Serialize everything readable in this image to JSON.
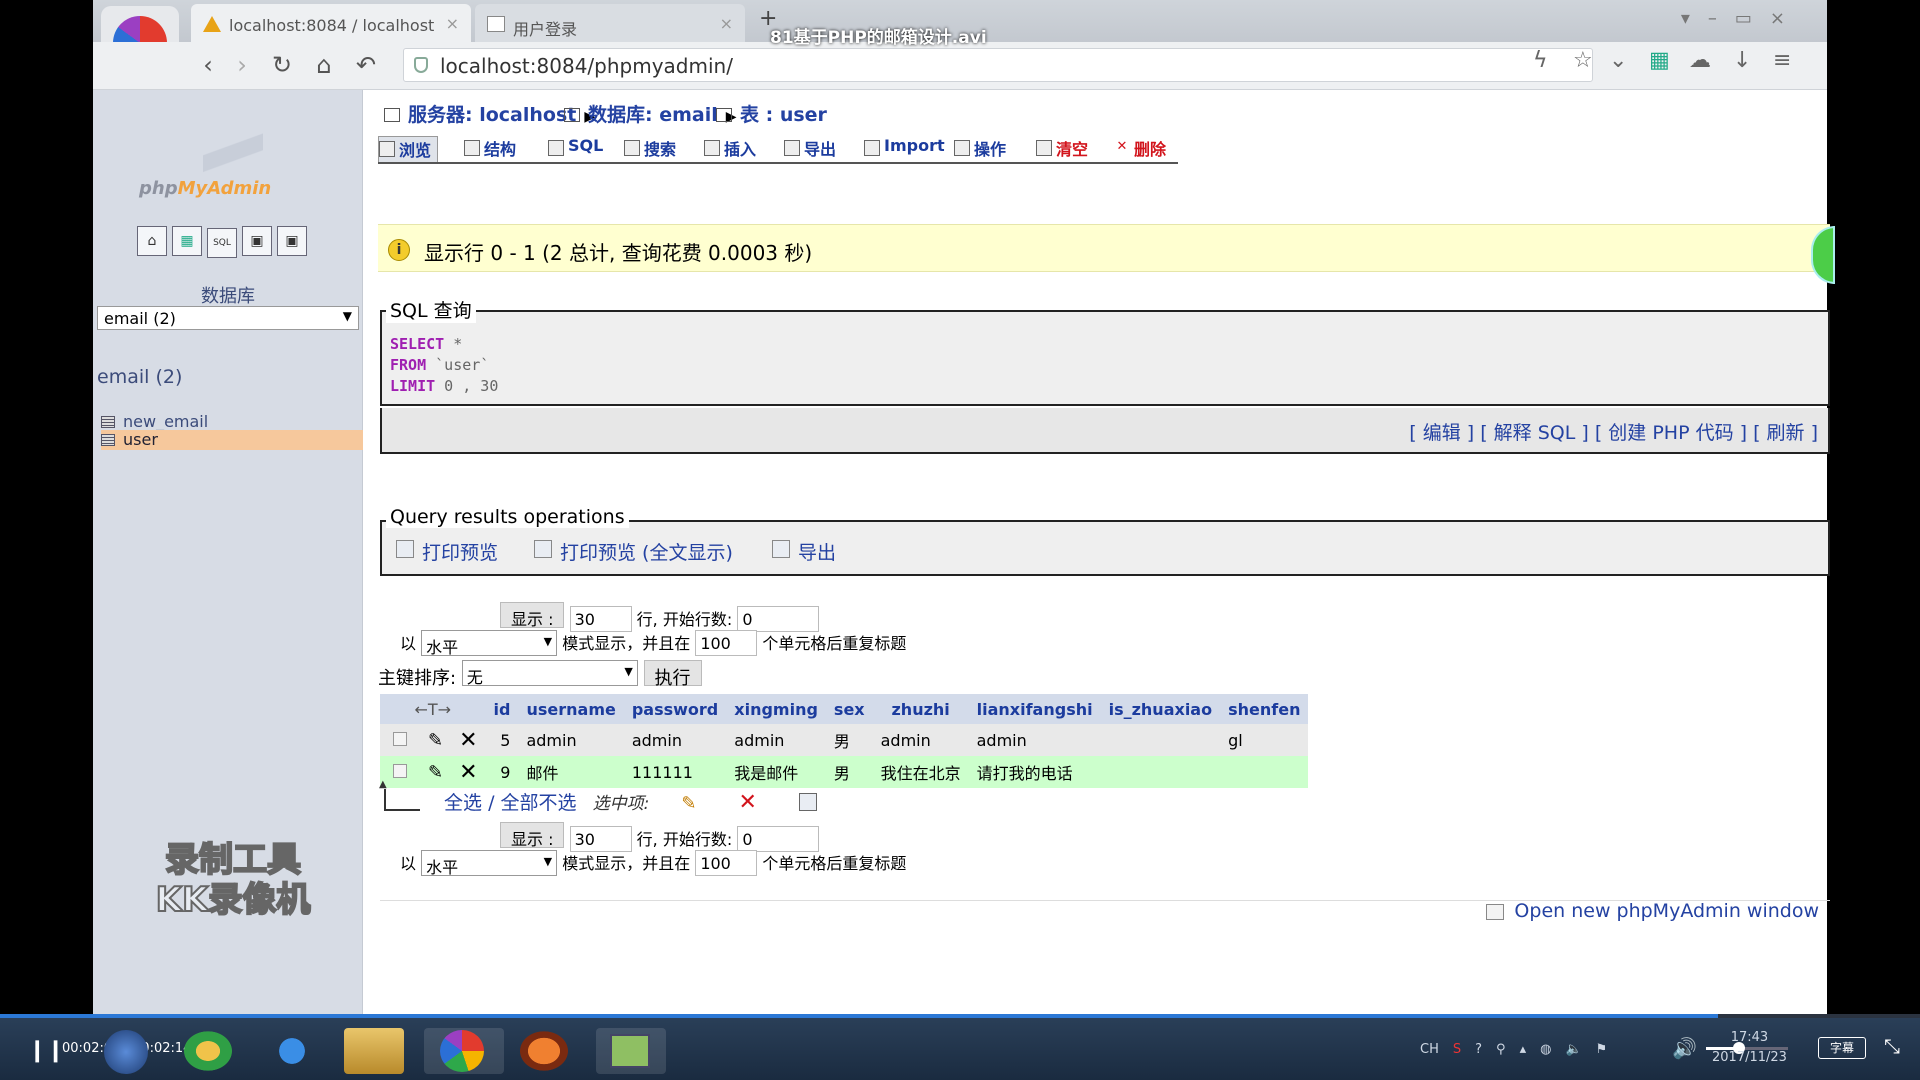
{
  "video": {
    "title": "81基于PHP的邮箱设计.avi",
    "time": "00:02:00 / 00:02:14",
    "progress_fraction": 0.895,
    "volume_fraction": 0.4,
    "subtitle_label": "字幕"
  },
  "browser": {
    "tabs": [
      {
        "label": "localhost:8084 / localhost"
      },
      {
        "label": "用户登录"
      }
    ],
    "new_tab": "+",
    "url": "localhost:8084/phpmyadmin/"
  },
  "left": {
    "logo_php": "php",
    "logo_my": "MyAdmin",
    "db_label": "数据库",
    "db_select": "email (2)",
    "db_name": "email (2)",
    "tables": [
      "new_email",
      "user"
    ],
    "watermark_line1": "录制工具",
    "watermark_line2": "KK录像机"
  },
  "breadcrumb": {
    "server": "服务器: localhost",
    "database": "数据库: email",
    "table": "表 : user"
  },
  "tabs": {
    "browse": "浏览",
    "structure": "结构",
    "sql": "SQL",
    "search": "搜索",
    "insert": "插入",
    "export": "导出",
    "import": "Import",
    "operations": "操作",
    "empty": "清空",
    "drop": "删除"
  },
  "notice": "显示行 0 - 1 (2 总计, 查询花费 0.0003 秒)",
  "sql": {
    "legend": "SQL 查询",
    "kw_select": "SELECT",
    "select_rest": " *",
    "kw_from": "FROM",
    "from_rest": " `user`",
    "kw_limit": "LIMIT",
    "limit_rest": " 0 , 30",
    "link_edit": "编辑",
    "link_explain": "解释 SQL",
    "link_php": "创建 PHP 代码",
    "link_refresh": "刷新"
  },
  "qro": {
    "legend": "Query results operations",
    "print": "打印预览",
    "print_full": "打印预览 (全文显示)",
    "export": "导出"
  },
  "controls": {
    "show_btn": "显示 :",
    "rows_value": "30",
    "rows_label": "行, 开始行数:",
    "start_value": "0",
    "in_label": "以",
    "mode_value": "水平",
    "mode_label": "模式显示，并且在",
    "repeat_value": "100",
    "repeat_label": "个单元格后重复标题",
    "sort_label": "主键排序:",
    "sort_value": "无",
    "go_btn": "执行"
  },
  "table": {
    "arrows": "←T→",
    "headers": [
      "id",
      "username",
      "password",
      "xingming",
      "sex",
      "zhuzhi",
      "lianxifangshi",
      "is_zhuaxiao",
      "shenfen"
    ],
    "rows": [
      [
        "5",
        "admin",
        "admin",
        "admin",
        "男",
        "admin",
        "admin",
        "",
        "gl"
      ],
      [
        "9",
        "邮件",
        "111111",
        "我是邮件",
        "男",
        "我住在北京",
        "请打我的电话",
        "",
        ""
      ]
    ]
  },
  "checkall": {
    "label": "全选 / 全部不选",
    "with_selected": "选中项:"
  },
  "open_window": "Open new phpMyAdmin window",
  "clock": {
    "time": "17:43",
    "date": "2017/11/23"
  },
  "tray": {
    "ime": "CH",
    "help": "?"
  }
}
